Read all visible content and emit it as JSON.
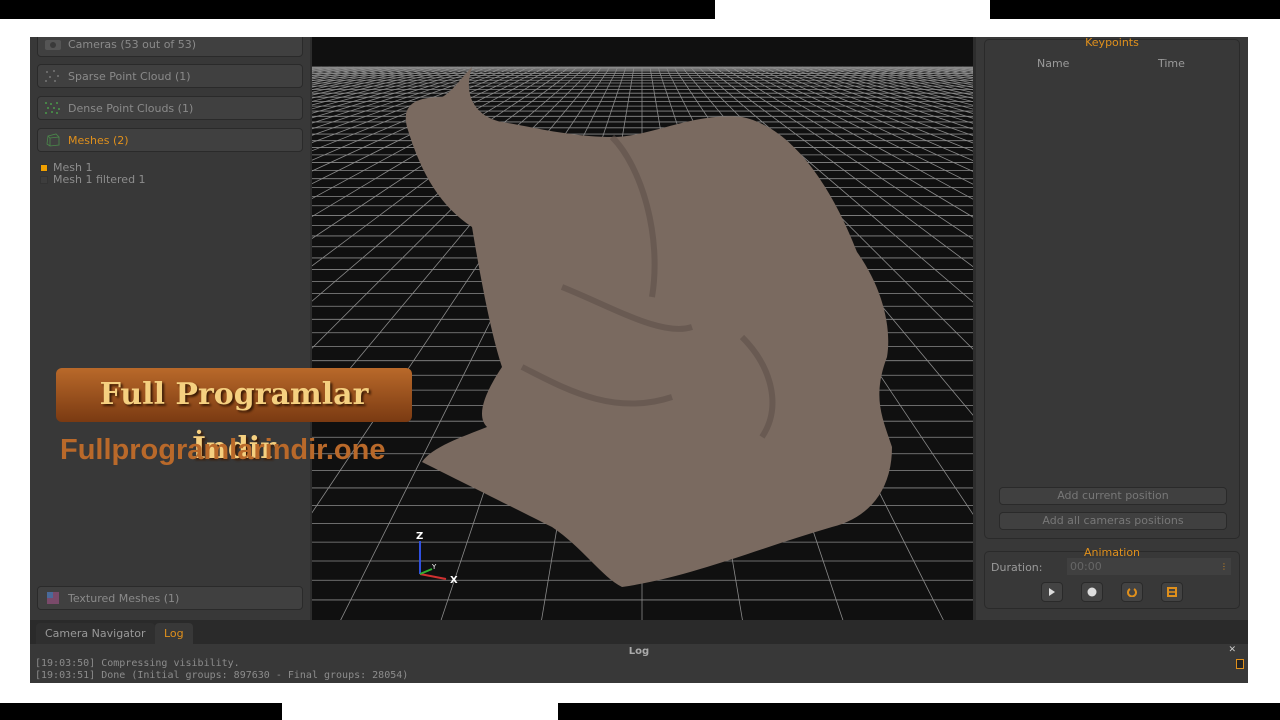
{
  "left_panel": {
    "groups": [
      {
        "label": "Cameras (53 out of 53)",
        "icon": "camera-icon"
      },
      {
        "label": "Sparse Point Cloud (1)",
        "icon": "sparse-cloud-icon"
      },
      {
        "label": "Dense Point Clouds (1)",
        "icon": "dense-cloud-icon"
      },
      {
        "label": "Meshes (2)",
        "icon": "mesh-icon",
        "active": true
      },
      {
        "label": "Textured Meshes (1)",
        "icon": "textured-mesh-icon"
      }
    ],
    "meshes": [
      {
        "label": "Mesh 1",
        "checked": true
      },
      {
        "label": "Mesh 1 filtered 1",
        "checked": false
      }
    ]
  },
  "viewport": {
    "axes": {
      "z": "Z",
      "y": "Y",
      "x": "X"
    }
  },
  "right_panel": {
    "keypoints": {
      "title": "Keypoints",
      "columns": [
        "Name",
        "Time"
      ],
      "add_current": "Add current position",
      "add_all": "Add all cameras positions"
    },
    "animation": {
      "title": "Animation",
      "duration_label": "Duration:",
      "duration_value": "00:00",
      "buttons": [
        "play-icon",
        "record-icon",
        "loop-icon",
        "save-icon"
      ]
    }
  },
  "bottom": {
    "tabs": [
      {
        "label": "Camera Navigator"
      },
      {
        "label": "Log",
        "active": true
      }
    ],
    "log_title": "Log",
    "log_lines": [
      "[19:03:50] Compressing visibility.",
      "[19:03:51] Done (Initial groups: 897630 - Final groups: 28054)"
    ]
  },
  "watermark": {
    "title": "Full Programlar İndir",
    "url": "Fullprogramlarindir.one"
  },
  "colors": {
    "accent": "#e0901c",
    "panel": "#383838",
    "mesh": "#7a6a60"
  }
}
